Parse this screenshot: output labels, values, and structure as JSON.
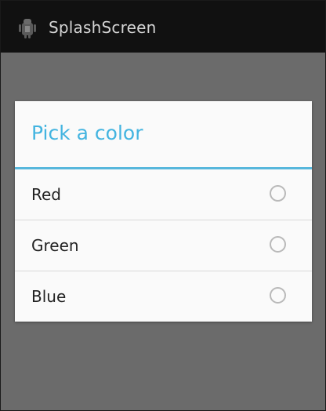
{
  "app": {
    "title": "SplashScreen",
    "icon": "android-robot-icon"
  },
  "dialog": {
    "title": "Pick a color",
    "accent_color": "#43b4e0",
    "options": [
      {
        "label": "Red",
        "selected": false
      },
      {
        "label": "Green",
        "selected": false
      },
      {
        "label": "Blue",
        "selected": false
      }
    ]
  },
  "colors": {
    "action_bar": "#111111",
    "dim_background": "#6b6b6b",
    "dialog_background": "#fafafa"
  }
}
